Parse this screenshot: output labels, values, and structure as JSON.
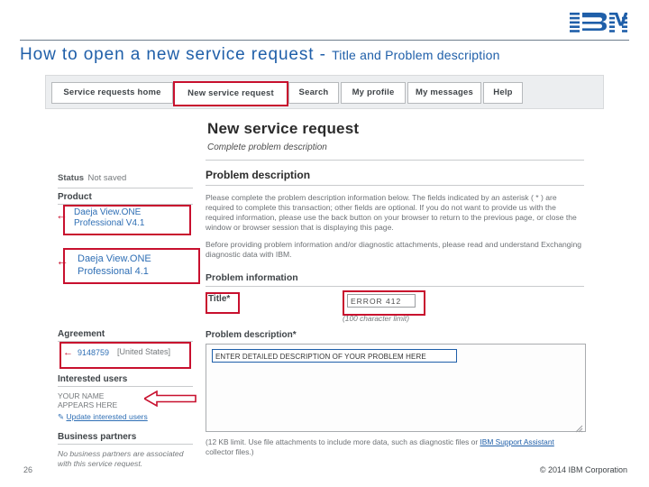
{
  "logo": {
    "alt": "IBM"
  },
  "slide": {
    "title_main": "How to open a new service request - ",
    "title_sub": "Title and Problem description",
    "page_number": "26",
    "copyright": "© 2014 IBM Corporation"
  },
  "nav": {
    "tabs": [
      {
        "label": "Service requests home",
        "highlight": false
      },
      {
        "label": "New service request",
        "highlight": true
      },
      {
        "label": "Search",
        "highlight": false
      },
      {
        "label": "My profile",
        "highlight": false
      },
      {
        "label": "My messages",
        "highlight": false
      },
      {
        "label": "Help",
        "highlight": false
      }
    ]
  },
  "page": {
    "heading": "New service request",
    "subheading": "Complete problem description"
  },
  "left": {
    "status_label": "Status",
    "status_value": "Not saved",
    "product_label": "Product",
    "product_value_line1": "Daeja View.ONE",
    "product_value_line2": "Professional V4.1",
    "product_value2_line1": "Daeja View.ONE",
    "product_value2_line2": "Professional 4.1",
    "agreement_label": "Agreement",
    "agreement_value": "9148759",
    "agreement_country": "[United States]",
    "users_label": "Interested users",
    "users_value_line1": "YOUR NAME",
    "users_value_line2": "APPEARS HERE",
    "users_update_link": "Update interested users",
    "partners_label": "Business partners",
    "partners_text": "No business partners are associated with this service request."
  },
  "right": {
    "problem_description_title": "Problem description",
    "paragraph1": "Please complete the problem description information below. The fields indicated by an asterisk ( * ) are required to complete this transaction; other fields are optional. If you do not want to provide us with the required information, please use the back button on your browser to return to the previous page, or close the window or browser session that is displaying this page.",
    "paragraph2": "Before providing problem information and/or diagnostic attachments, please read and understand Exchanging diagnostic data with IBM.",
    "problem_information_title": "Problem information",
    "title_field_label": "Title",
    "title_field_required": "*",
    "title_field_value": "ERROR 412",
    "char_limit_note": "(100 character limit)",
    "problem_desc_label": "Problem description",
    "problem_desc_required": "*",
    "textarea_value": "ENTER DETAILED DESCRIPTION OF YOUR PROBLEM HERE",
    "attachment_note_part1": "(12 KB limit. Use file attachments to include more data, such as diagnostic files or ",
    "attachment_note_link": "IBM Support Assistant",
    "attachment_note_part2": " collector files.)"
  }
}
